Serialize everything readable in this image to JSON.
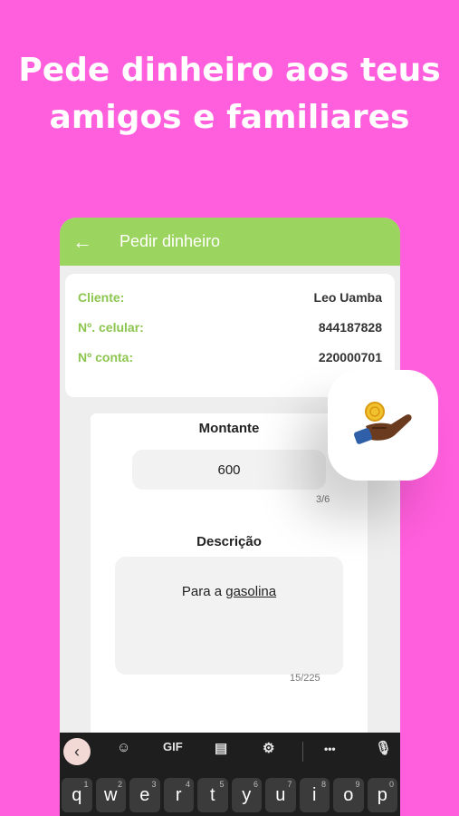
{
  "headline": {
    "line1": "Pede dinheiro aos teus",
    "line2": "amigos e familiares"
  },
  "appbar": {
    "title": "Pedir dinheiro"
  },
  "client_info": [
    {
      "label": "Cliente:",
      "value": "Leo Uamba"
    },
    {
      "label": "Nº. celular:",
      "value": "844187828"
    },
    {
      "label": "Nº conta:",
      "value": "220000701"
    }
  ],
  "amount": {
    "title": "Montante",
    "value": "600",
    "counter": "3/6"
  },
  "description": {
    "title": "Descrição",
    "value_prefix": "Para a ",
    "value_word": "gasolina",
    "counter": "15/225"
  },
  "keyboard": {
    "toolbar": {
      "gif": "GIF",
      "more": "•••"
    },
    "keys": [
      {
        "char": "q",
        "num": "1"
      },
      {
        "char": "w",
        "num": "2"
      },
      {
        "char": "e",
        "num": "3"
      },
      {
        "char": "r",
        "num": "4"
      },
      {
        "char": "t",
        "num": "5"
      },
      {
        "char": "y",
        "num": "6"
      },
      {
        "char": "u",
        "num": "7"
      },
      {
        "char": "i",
        "num": "8"
      },
      {
        "char": "o",
        "num": "9"
      },
      {
        "char": "p",
        "num": "0"
      }
    ]
  },
  "colors": {
    "background": "#ff5edc",
    "appbar": "#9bd45e",
    "label": "#8cc54f"
  }
}
